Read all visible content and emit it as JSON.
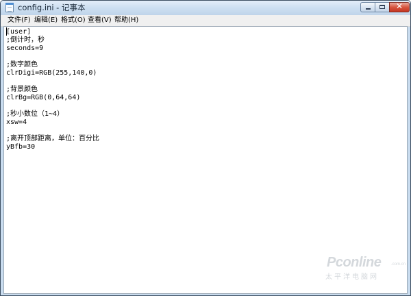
{
  "window": {
    "title": "config.ini - 记事本"
  },
  "menu": {
    "items": [
      {
        "label": "文件(F)"
      },
      {
        "label": "编辑(E)"
      },
      {
        "label": "格式(O)"
      },
      {
        "label": "查看(V)"
      },
      {
        "label": "帮助(H)"
      }
    ]
  },
  "editor": {
    "lines": [
      "[user]",
      ";倒计时，秒",
      "seconds=9",
      "",
      ";数字颜色",
      "clrDigi=RGB(255,140,0)",
      "",
      ";背景颜色",
      "clrBg=RGB(0,64,64)",
      "",
      ";秒小数位（1~4）",
      "xsw=4",
      "",
      ";离开顶部距离，单位：百分比",
      "yBfb=30"
    ]
  },
  "watermark": {
    "brand": "Pconline",
    "sub": "太平洋电脑网",
    "tld": ".com.cn"
  },
  "icons": {
    "app": "notepad-icon",
    "minimize": "minimize-icon",
    "maximize": "maximize-icon",
    "close": "close-icon"
  }
}
